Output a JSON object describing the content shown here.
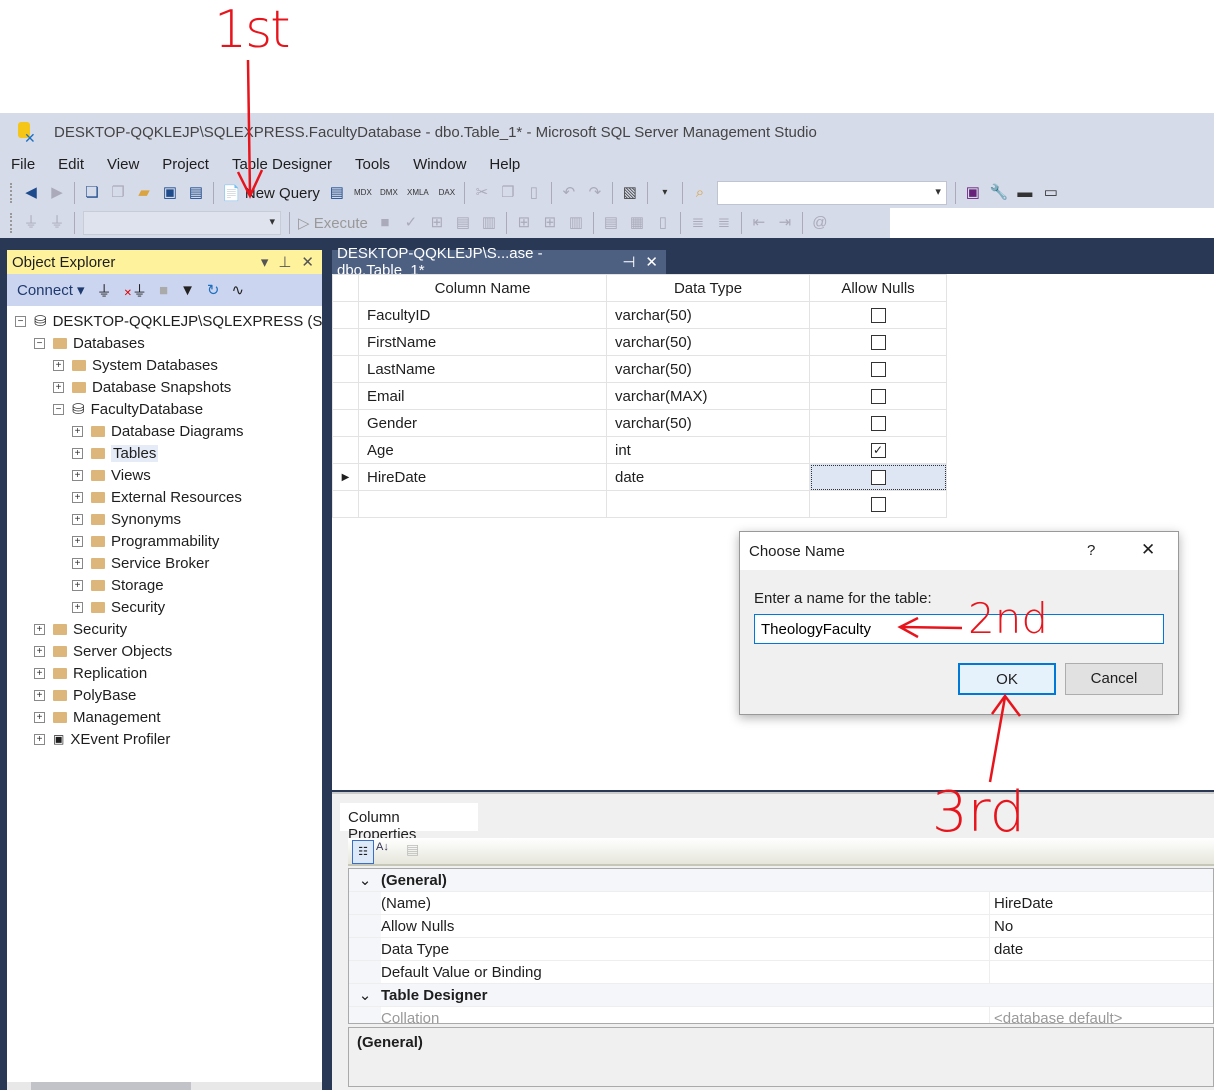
{
  "window": {
    "title": "DESKTOP-QQKLEJP\\SQLEXPRESS.FacultyDatabase - dbo.Table_1* - Microsoft SQL Server Management Studio"
  },
  "menu": [
    "File",
    "Edit",
    "View",
    "Project",
    "Table Designer",
    "Tools",
    "Window",
    "Help"
  ],
  "toolbar": {
    "new_query": "New Query",
    "execute": "Execute",
    "mdx": "MDX",
    "dmx": "DMX",
    "xmla": "XMLA",
    "dax": "DAX"
  },
  "object_explorer": {
    "title": "Object Explorer",
    "connect": "Connect",
    "nodes": [
      {
        "label": "DESKTOP-QQKLEJP\\SQLEXPRESS (SQL Server)",
        "level": 0,
        "exp": "-",
        "icon": "server"
      },
      {
        "label": "Databases",
        "level": 1,
        "exp": "-",
        "icon": "folder"
      },
      {
        "label": "System Databases",
        "level": 2,
        "exp": "+",
        "icon": "folder"
      },
      {
        "label": "Database Snapshots",
        "level": 2,
        "exp": "+",
        "icon": "folder"
      },
      {
        "label": "FacultyDatabase",
        "level": 2,
        "exp": "-",
        "icon": "database"
      },
      {
        "label": "Database Diagrams",
        "level": 3,
        "exp": "+",
        "icon": "folder"
      },
      {
        "label": "Tables",
        "level": 3,
        "exp": "+",
        "icon": "folder",
        "selected": true
      },
      {
        "label": "Views",
        "level": 3,
        "exp": "+",
        "icon": "folder"
      },
      {
        "label": "External Resources",
        "level": 3,
        "exp": "+",
        "icon": "folder"
      },
      {
        "label": "Synonyms",
        "level": 3,
        "exp": "+",
        "icon": "folder"
      },
      {
        "label": "Programmability",
        "level": 3,
        "exp": "+",
        "icon": "folder"
      },
      {
        "label": "Service Broker",
        "level": 3,
        "exp": "+",
        "icon": "folder"
      },
      {
        "label": "Storage",
        "level": 3,
        "exp": "+",
        "icon": "folder"
      },
      {
        "label": "Security",
        "level": 3,
        "exp": "+",
        "icon": "folder"
      },
      {
        "label": "Security",
        "level": 1,
        "exp": "+",
        "icon": "folder"
      },
      {
        "label": "Server Objects",
        "level": 1,
        "exp": "+",
        "icon": "folder"
      },
      {
        "label": "Replication",
        "level": 1,
        "exp": "+",
        "icon": "folder"
      },
      {
        "label": "PolyBase",
        "level": 1,
        "exp": "+",
        "icon": "folder"
      },
      {
        "label": "Management",
        "level": 1,
        "exp": "+",
        "icon": "folder"
      },
      {
        "label": "XEvent Profiler",
        "level": 1,
        "exp": "+",
        "icon": "xevent"
      }
    ]
  },
  "doc_tab": {
    "label": "DESKTOP-QQKLEJP\\S...ase - dbo.Table_1*"
  },
  "grid": {
    "headers": [
      "Column Name",
      "Data Type",
      "Allow Nulls"
    ],
    "rows": [
      {
        "name": "FacultyID",
        "type": "varchar(50)",
        "nulls": false
      },
      {
        "name": "FirstName",
        "type": "varchar(50)",
        "nulls": false
      },
      {
        "name": "LastName",
        "type": "varchar(50)",
        "nulls": false
      },
      {
        "name": "Email",
        "type": "varchar(MAX)",
        "nulls": false
      },
      {
        "name": "Gender",
        "type": "varchar(50)",
        "nulls": false
      },
      {
        "name": "Age",
        "type": "int",
        "nulls": true
      },
      {
        "name": "HireDate",
        "type": "date",
        "nulls": false,
        "current": true
      },
      {
        "name": "",
        "type": "",
        "nulls": false
      }
    ]
  },
  "column_properties": {
    "tab": "Column Properties",
    "rows": [
      {
        "cat": true,
        "k": "(General)"
      },
      {
        "k": "(Name)",
        "v": "HireDate"
      },
      {
        "k": "Allow Nulls",
        "v": "No"
      },
      {
        "k": "Data Type",
        "v": "date"
      },
      {
        "k": "Default Value or Binding",
        "v": ""
      },
      {
        "cat": true,
        "k": "Table Designer"
      },
      {
        "k": "Collation",
        "v": "<database default>",
        "dim": true
      }
    ],
    "description": "(General)"
  },
  "dialog": {
    "title": "Choose Name",
    "help": "?",
    "prompt": "Enter a name for the table:",
    "value": "TheologyFaculty",
    "ok": "OK",
    "cancel": "Cancel"
  },
  "annotations": {
    "first": "1st",
    "second": "2nd",
    "third": "3rd",
    "color": "#e8141c"
  }
}
